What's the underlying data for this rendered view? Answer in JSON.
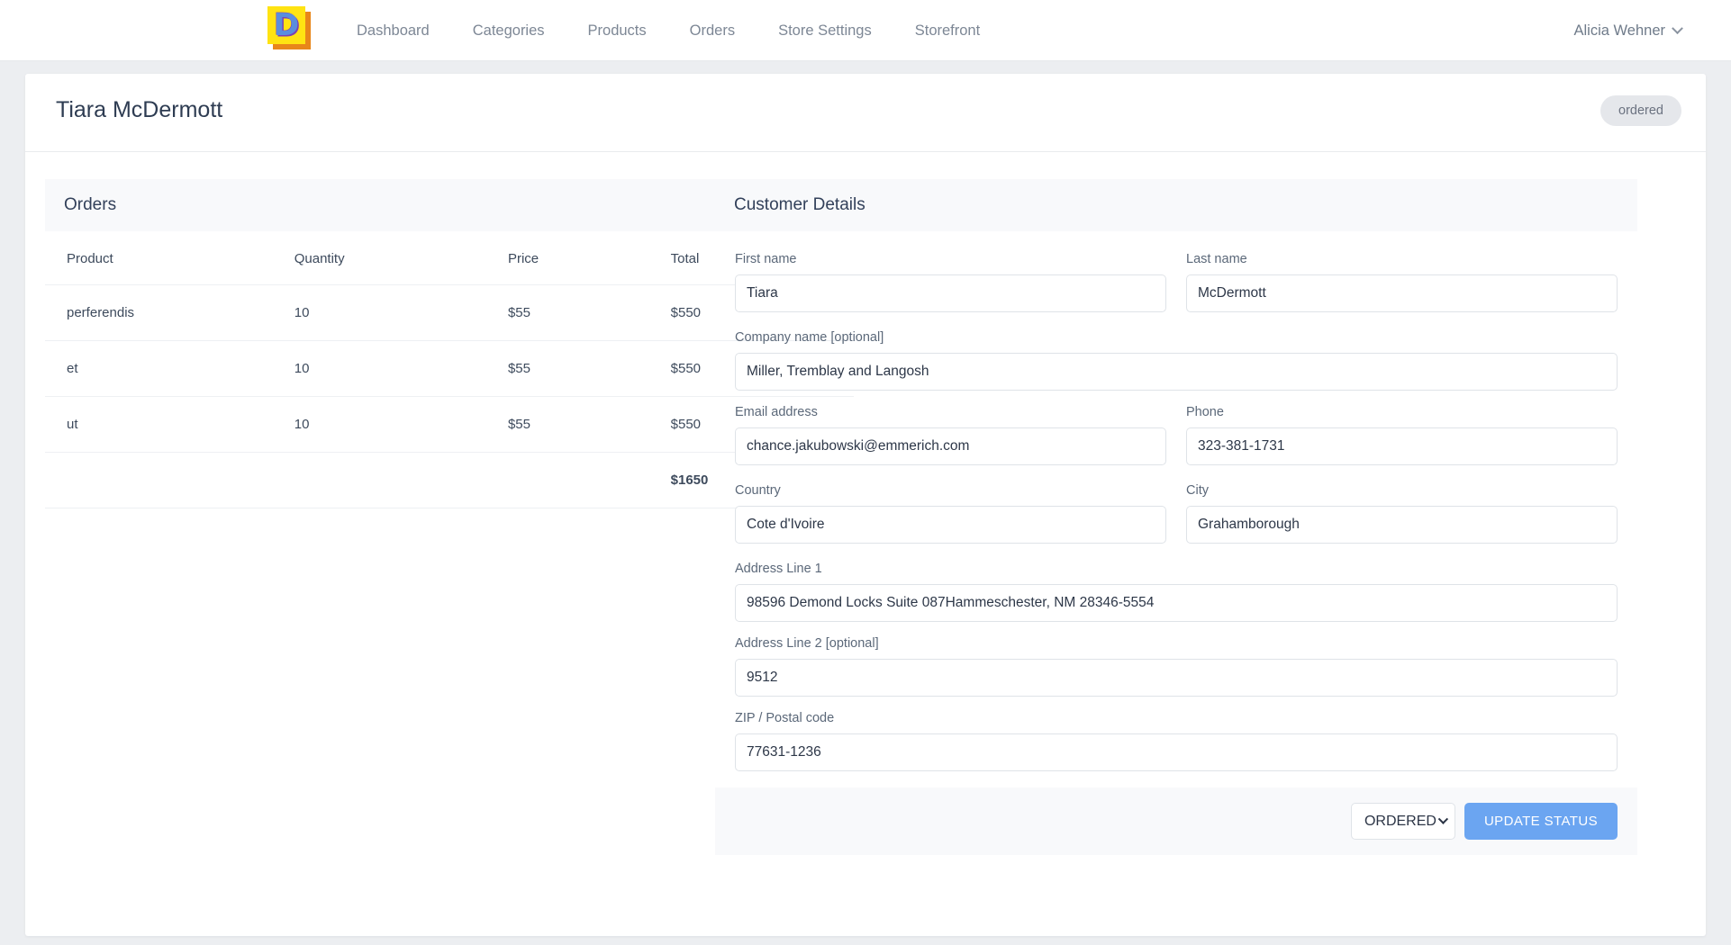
{
  "nav": {
    "logo_letter": "D",
    "logo_name": "app-logo",
    "links": [
      {
        "label": "Dashboard"
      },
      {
        "label": "Categories"
      },
      {
        "label": "Products"
      },
      {
        "label": "Orders"
      },
      {
        "label": "Store Settings"
      },
      {
        "label": "Storefront"
      }
    ],
    "user": {
      "name": "Alicia Wehner",
      "caret_icon": "chevron-down-icon"
    }
  },
  "header": {
    "title": "Tiara McDermott",
    "status_badge": "ordered"
  },
  "orders_panel": {
    "title": "Orders",
    "columns": [
      "Product",
      "Quantity",
      "Price",
      "Total"
    ],
    "rows": [
      {
        "product": "perferendis",
        "quantity": "10",
        "price": "$55",
        "total": "$550"
      },
      {
        "product": "et",
        "quantity": "10",
        "price": "$55",
        "total": "$550"
      },
      {
        "product": "ut",
        "quantity": "10",
        "price": "$55",
        "total": "$550"
      }
    ],
    "grand_total": "$1650"
  },
  "customer_panel": {
    "title": "Customer Details",
    "fields": {
      "first_name": {
        "label": "First name",
        "value": "Tiara"
      },
      "last_name": {
        "label": "Last name",
        "value": "McDermott"
      },
      "company": {
        "label": "Company name [optional]",
        "value": "Miller, Tremblay and Langosh"
      },
      "email": {
        "label": "Email address",
        "value": "chance.jakubowski@emmerich.com"
      },
      "phone": {
        "label": "Phone",
        "value": "323-381-1731"
      },
      "country": {
        "label": "Country",
        "value": "Cote d'Ivoire"
      },
      "city": {
        "label": "City",
        "value": "Grahamborough"
      },
      "address1": {
        "label": "Address Line 1",
        "value": "98596 Demond Locks Suite 087Hammeschester, NM 28346-5554"
      },
      "address2": {
        "label": "Address Line 2 [optional]",
        "value": "9512"
      },
      "zip": {
        "label": "ZIP / Postal code",
        "value": "77631-1236"
      }
    },
    "footer": {
      "status_selected": "ORDERED",
      "update_button": "UPDATE STATUS"
    }
  },
  "colors": {
    "page_background": "#eceef1",
    "card_background": "#ffffff",
    "panel_header": "#f8f9fb",
    "primary_button": "#6ba5f1",
    "badge_background": "#e5e7eb",
    "logo_yellow": "#ffe312",
    "logo_orange": "#e8861a",
    "logo_blue": "#5a8dde",
    "logo_purple": "#7b3fb5"
  }
}
